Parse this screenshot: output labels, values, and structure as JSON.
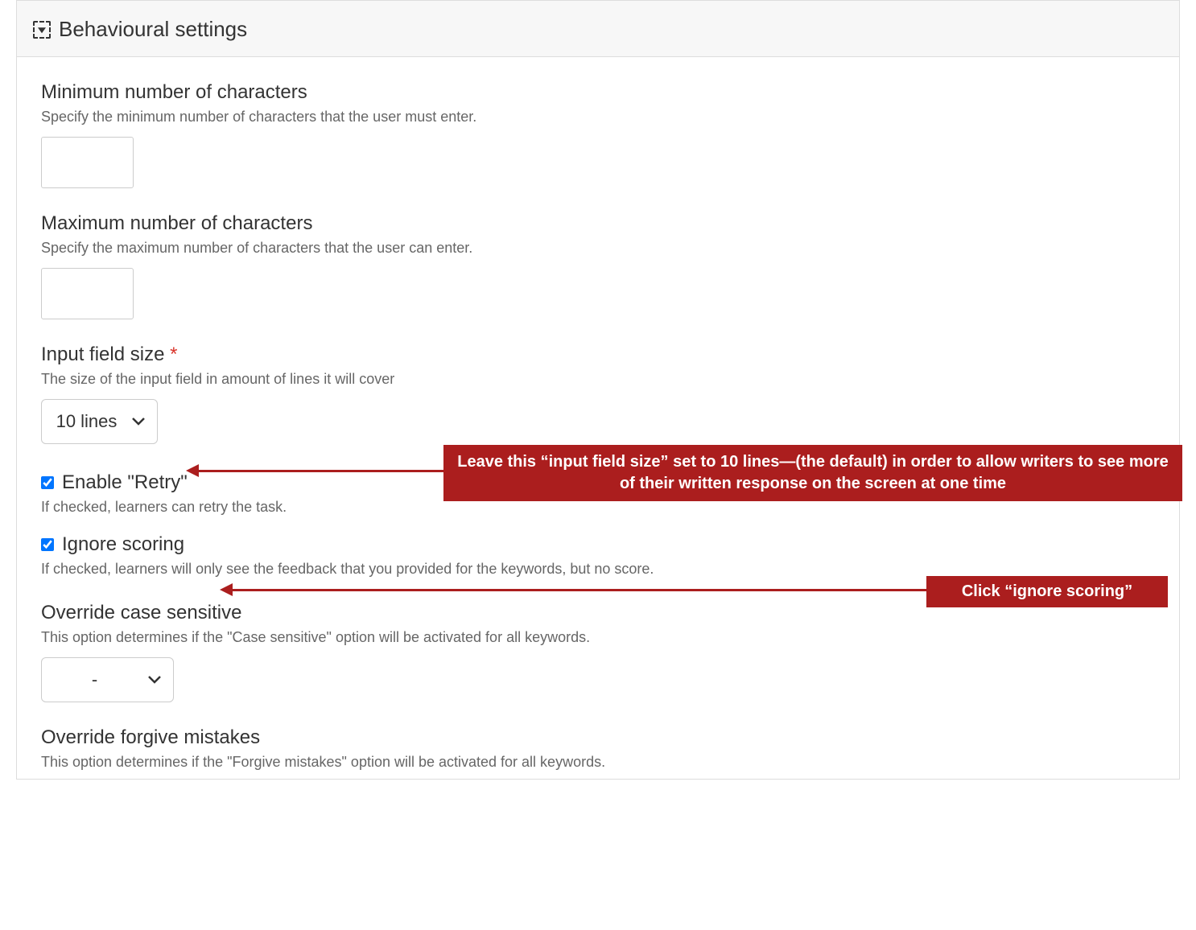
{
  "panel": {
    "title": "Behavioural settings"
  },
  "fields": {
    "min_chars": {
      "label": "Minimum number of characters",
      "desc": "Specify the minimum number of characters that the user must enter.",
      "value": ""
    },
    "max_chars": {
      "label": "Maximum number of characters",
      "desc": "Specify the maximum number of characters that the user can enter.",
      "value": ""
    },
    "input_size": {
      "label": "Input field size",
      "required_mark": "*",
      "desc": "The size of the input field in amount of lines it will cover",
      "selected": "10 lines"
    },
    "enable_retry": {
      "label": "Enable \"Retry\"",
      "desc": "If checked, learners can retry the task.",
      "checked": true
    },
    "ignore_scoring": {
      "label": "Ignore scoring",
      "desc": "If checked, learners will only see the feedback that you provided for the keywords, but no score.",
      "checked": true
    },
    "override_case": {
      "label": "Override case sensitive",
      "desc": "This option determines if the \"Case sensitive\" option will be activated for all keywords.",
      "selected": "-"
    },
    "override_forgive": {
      "label": "Override forgive mistakes",
      "desc": "This option determines if the \"Forgive mistakes\" option will be activated for all keywords."
    }
  },
  "callouts": {
    "input_size_note": "Leave this “input field size” set to 10 lines—(the default) in order to allow writers to see more of their written response on the screen at one time",
    "ignore_scoring_note": "Click “ignore scoring”"
  }
}
